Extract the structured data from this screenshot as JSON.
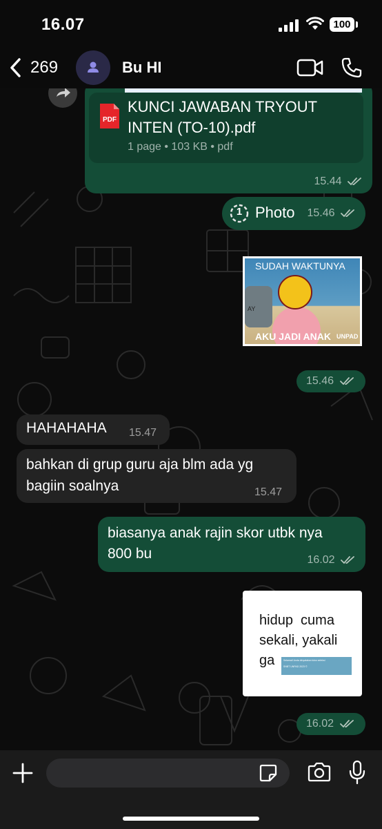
{
  "status": {
    "time": "16.07",
    "battery": "100"
  },
  "header": {
    "back_count": "269",
    "contact_name": "Bu HI"
  },
  "messages": {
    "doc": {
      "icon_label": "PDF",
      "filename_line1": "KUNCI JAWABAN TRYOUT",
      "filename_line2": "INTEN (TO-10).pdf",
      "info": "1 page • 103 KB • pdf",
      "time": "15.44"
    },
    "view_once": {
      "label": "Photo",
      "count": "1",
      "time": "15.46"
    },
    "meme1": {
      "top_text": "SUDAH WAKTUNYA",
      "bottom_text": "AKU JADI ANAK",
      "tag": "UNPAD",
      "small": "AY",
      "time": "15.46"
    },
    "in1": {
      "text": "HAHAHAHA",
      "time": "15.47"
    },
    "in2": {
      "line1": "bahkan di grup guru aja blm ada yg",
      "line2": "bagiin soalnya",
      "time": "15.47"
    },
    "out1": {
      "line1": "biasanya anak rajin skor utbk nya",
      "line2": "800 bu",
      "time": "16.02"
    },
    "meme2": {
      "line1": "hidup  cuma",
      "line2": "sekali, yakali",
      "line3": "ga",
      "banner1": "Selamat! Anda dinyatakan lulus seleksi",
      "banner2": "SNBT UNPAD 2023 ©",
      "time": "16.02"
    }
  },
  "colors": {
    "outgoing": "#144d37",
    "incoming": "#232323",
    "read_ticks": "#b5c6bd"
  }
}
